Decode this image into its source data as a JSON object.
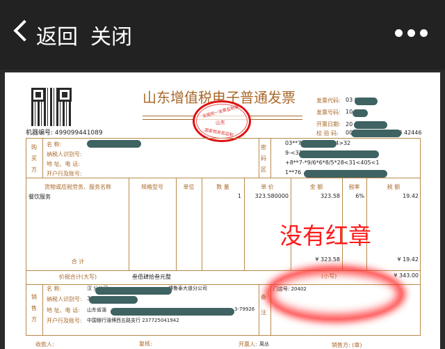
{
  "nav": {
    "back": "返回",
    "close": "关闭"
  },
  "invoice": {
    "title": "山东增值税电子普通发票",
    "stamp": {
      "top": "全国统一发票监制章",
      "middle": "山东",
      "bottom": "国家税务局监制"
    },
    "machine_no": "机器编号: 499099441089",
    "code_label": "发票代码:",
    "code": "03        0111",
    "number_label": "发票号码:",
    "number": "10      89",
    "date_label": "开票日期:",
    "date": "20              日",
    "check_label": "校 验 码:",
    "check": "00129 94948 35703 42446",
    "buyer": {
      "side": "购买方",
      "name": "名        称:",
      "tax_id": "纳税人识别号:",
      "addr": "地 址、电 话:",
      "bank": "开户行及账号:"
    },
    "cipher": {
      "side": "密码区",
      "lines": [
        "03**7               6*25>16804>32",
        "9-<31",
        "+8**7-*9/6*6*8/5*28<31<405<1",
        "1**76"
      ]
    },
    "items_header": [
      "货物或应税劳务、服务名称",
      "规格型号",
      "单位",
      "数 量",
      "单 价",
      "金 额",
      "税率",
      "税 额"
    ],
    "item": {
      "name": "餐饮服务",
      "qty": "1",
      "price": "323.580000",
      "amount": "323.58",
      "rate": "6%",
      "tax": "19.42"
    },
    "subtotal_label": "合        计",
    "subtotal_amount": "¥ 323.58",
    "subtotal_tax": "¥ 19.42",
    "total_label": "价税合计(大写)",
    "total_words": "叁佰肆拾叁元整",
    "small_label": "(小写)",
    "total": "¥ 343.00",
    "seller": {
      "side": "销售方",
      "name": "名        称:",
      "name_val": "汉             分公司",
      "name_tail": "博鲁泰大道分公司",
      "tax_id": "纳税人识别号:",
      "tax_id_val": "3                 2",
      "addr": "地 址、电 话:",
      "addr_val": "山东省淄",
      "addr_tail": "3-79926",
      "bank": "开户行及账号:",
      "bank_val": "中国银行淄博西五路支行 237725041942"
    },
    "remark": {
      "side": "备注",
      "text": "门店号: 20402"
    },
    "footer": {
      "payee": "收款人:",
      "review": "复核:",
      "drawer": "开票人:",
      "drawer_val": "周丛",
      "seller_seal": "销售方: (章)"
    }
  },
  "annotation": "没有红章",
  "colors": {
    "header_bg": "#222222",
    "invoice_brown": "#a8682a",
    "annotation_red": "#ff1a1a",
    "redaction": "#3f6262"
  }
}
